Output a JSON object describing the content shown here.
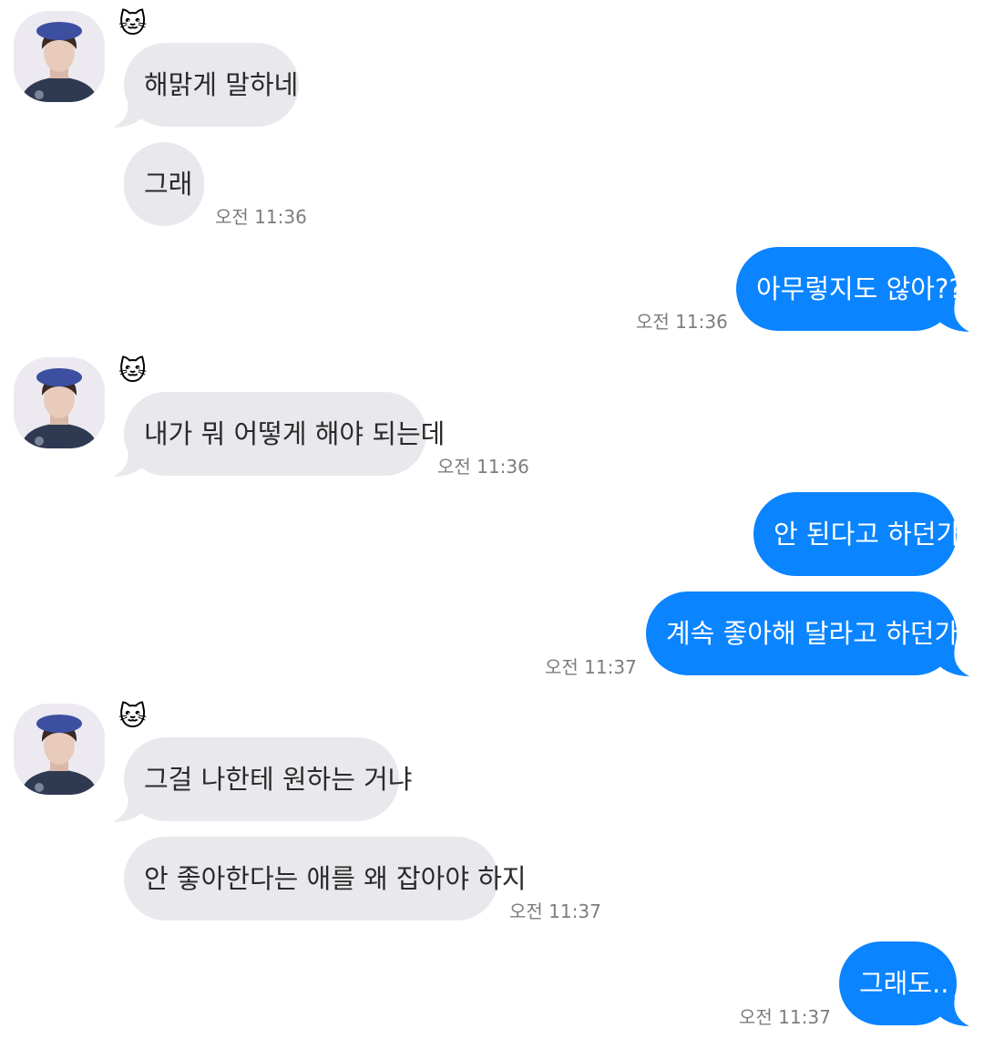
{
  "colors": {
    "incoming_bubble": "#e9e9ed",
    "outgoing_bubble": "#0a84ff",
    "timestamp": "#7d7d7d"
  },
  "sender_icon": "cat-face",
  "sender_label": "🐱",
  "messages": [
    {
      "direction": "incoming",
      "text": "해맑게 말하네"
    },
    {
      "direction": "incoming",
      "text": "그래",
      "time": "오전 11:36"
    },
    {
      "direction": "outgoing",
      "text": "아무렇지도 않아??",
      "time": "오전 11:36"
    },
    {
      "direction": "incoming",
      "text": "내가 뭐 어떻게 해야 되는데",
      "time": "오전 11:36"
    },
    {
      "direction": "outgoing",
      "text": "안 된다고 하던가"
    },
    {
      "direction": "outgoing",
      "text": "계속 좋아해 달라고 하던가..",
      "time": "오전 11:37"
    },
    {
      "direction": "incoming",
      "text": "그걸 나한테 원하는 거냐"
    },
    {
      "direction": "incoming",
      "text": "안 좋아한다는 애를 왜 잡아야 하지",
      "time": "오전 11:37"
    },
    {
      "direction": "outgoing",
      "text": "그래도..",
      "time": "오전 11:37"
    }
  ]
}
